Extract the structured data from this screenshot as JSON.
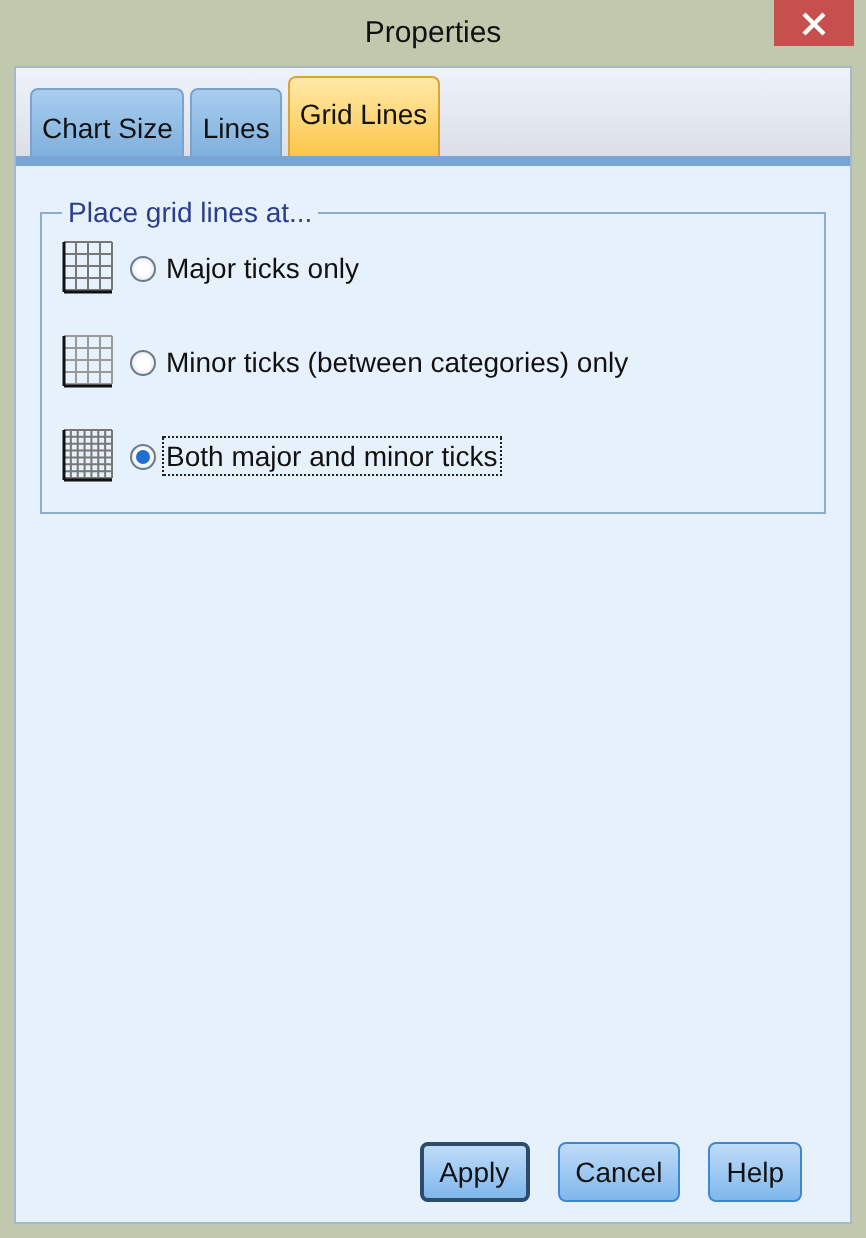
{
  "window": {
    "title": "Properties"
  },
  "tabs": [
    {
      "label": "Chart Size",
      "selected": false
    },
    {
      "label": "Lines",
      "selected": false
    },
    {
      "label": "Grid Lines",
      "selected": true
    }
  ],
  "group": {
    "title": "Place grid lines at...",
    "options": [
      {
        "kind": "major",
        "label": "Major ticks only",
        "selected": false
      },
      {
        "kind": "minor",
        "label": "Minor ticks (between categories) only",
        "selected": false
      },
      {
        "kind": "both",
        "label": "Both major and minor ticks",
        "selected": true
      }
    ]
  },
  "buttons": [
    {
      "label": "Apply",
      "default": true
    },
    {
      "label": "Cancel",
      "default": false
    },
    {
      "label": "Help",
      "default": false
    }
  ]
}
